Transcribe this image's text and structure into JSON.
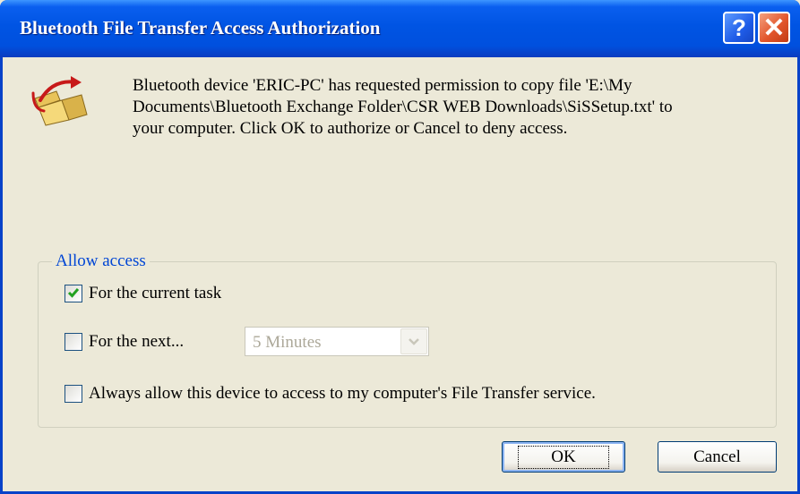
{
  "window": {
    "title": "Bluetooth File Transfer Access Authorization",
    "help_label": "?",
    "close_label": "✕"
  },
  "message": {
    "line1": "Bluetooth device 'ERIC-PC' has requested permission to copy file 'E:\\My",
    "line2": "Documents\\Bluetooth Exchange Folder\\CSR WEB Downloads\\SiSSetup.txt' to",
    "line3": "your computer.  Click OK to authorize or Cancel to deny access."
  },
  "access": {
    "group_label": "Allow access",
    "options": [
      {
        "label": "For the current task",
        "checked": true
      },
      {
        "label": "For the next...",
        "checked": false
      },
      {
        "label": "Always allow this device to access to my computer's File Transfer service.",
        "checked": false
      }
    ],
    "duration": {
      "value": "5 Minutes",
      "enabled": false
    }
  },
  "buttons": {
    "ok": "OK",
    "cancel": "Cancel"
  },
  "colors": {
    "titlebar": "#0054e3",
    "window_bg": "#ece9d8",
    "group_label": "#0046d5",
    "check": "#21a121",
    "close_button": "#e2562c"
  }
}
